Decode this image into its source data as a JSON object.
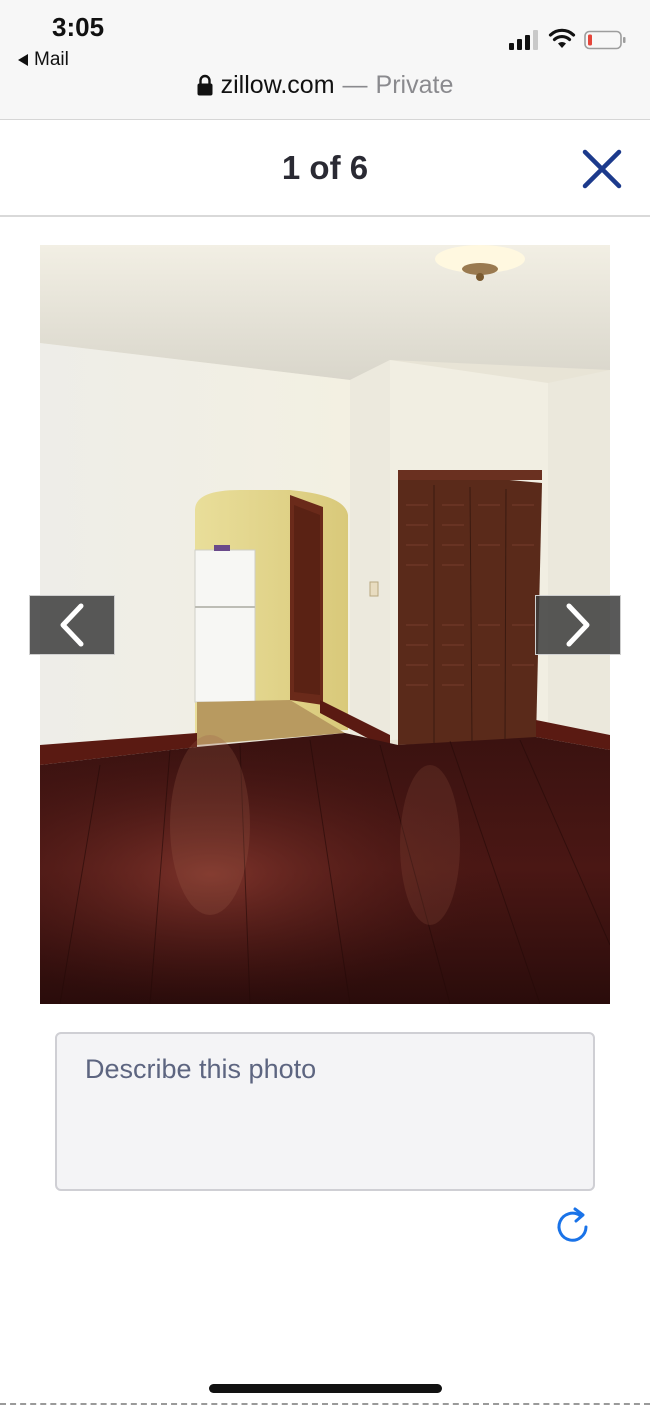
{
  "status_bar": {
    "time": "3:05",
    "back_app": "Mail",
    "url_domain": "zillow.com",
    "url_separator": "—",
    "url_private": "Private",
    "icons": [
      "back-triangle-icon",
      "cellular-signal-icon",
      "wifi-icon",
      "battery-low-icon",
      "lock-icon"
    ],
    "battery_color": "#e5453a"
  },
  "viewer": {
    "counter": "1 of 6",
    "close_icon": "close-icon",
    "accent_color": "#1c3a8c",
    "prev_icon": "chevron-left-icon",
    "next_icon": "chevron-right-icon",
    "photo": "empty apartment room with dark hardwood floor, arched doorway to kitchen with white refrigerator, brown louvered closet doors"
  },
  "description": {
    "placeholder": "Describe this photo",
    "value": ""
  },
  "refresh": {
    "icon": "refresh-icon",
    "color": "#1a73e8"
  }
}
